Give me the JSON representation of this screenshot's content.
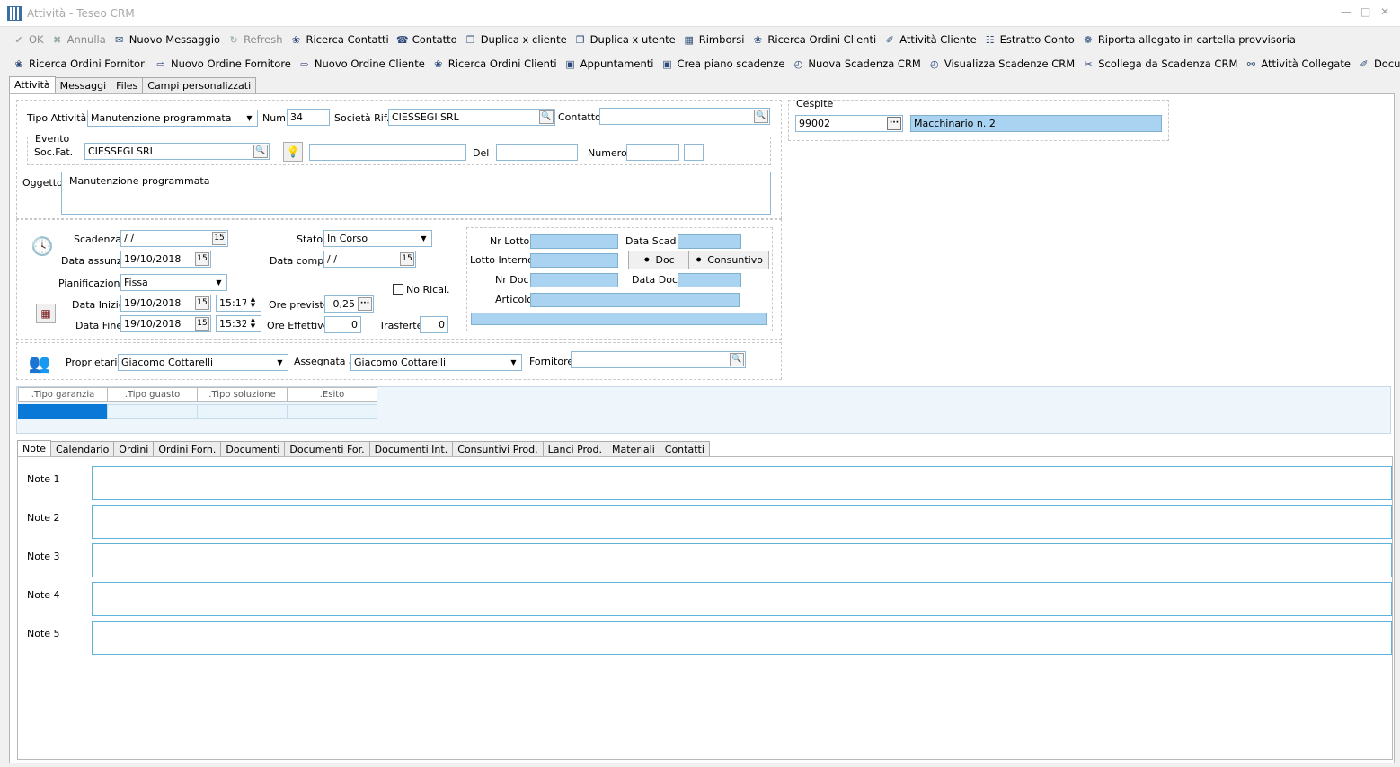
{
  "window": {
    "title": "Attività - Teseo CRM"
  },
  "toolbar1": [
    {
      "label": "OK",
      "icon": "check-icon",
      "disabled": true
    },
    {
      "label": "Annulla",
      "icon": "x-icon",
      "disabled": true
    },
    {
      "label": "Nuovo Messaggio",
      "icon": "envelope-icon"
    },
    {
      "label": "Refresh",
      "icon": "refresh-icon",
      "disabled": true
    },
    {
      "label": "Ricerca Contatti",
      "icon": "search-icon"
    },
    {
      "label": "Contatto",
      "icon": "contact-icon"
    },
    {
      "label": "Duplica x cliente",
      "icon": "copy-icon"
    },
    {
      "label": "Duplica x utente",
      "icon": "copy-icon"
    },
    {
      "label": "Rimborsi",
      "icon": "calculator-icon"
    },
    {
      "label": "Ricerca Ordini Clienti",
      "icon": "search-icon"
    },
    {
      "label": "Attività Cliente",
      "icon": "tag-icon"
    },
    {
      "label": "Estratto Conto",
      "icon": "statement-icon"
    },
    {
      "label": "Riporta allegato in cartella provvisoria",
      "icon": "attachment-icon"
    }
  ],
  "toolbar2": [
    {
      "label": "Ricerca Ordini Fornitori",
      "icon": "search-icon"
    },
    {
      "label": "Nuovo Ordine Fornitore",
      "icon": "arrow-icon"
    },
    {
      "label": "Nuovo Ordine Cliente",
      "icon": "arrow-icon"
    },
    {
      "label": "Ricerca Ordini Clienti",
      "icon": "search-icon"
    },
    {
      "label": "Appuntamenti",
      "icon": "calendar-icon"
    },
    {
      "label": "Crea piano scadenze",
      "icon": "calendar-icon"
    },
    {
      "label": "Nuova Scadenza CRM",
      "icon": "deadline-icon"
    },
    {
      "label": "Visualizza Scadenze CRM",
      "icon": "deadline-icon"
    },
    {
      "label": "Scollega da Scadenza CRM",
      "icon": "unlink-icon"
    },
    {
      "label": "Attività Collegate",
      "icon": "link-icon"
    },
    {
      "label": "Documenti CRM",
      "icon": "tag-icon"
    }
  ],
  "main_tabs": [
    "Attività",
    "Messaggi",
    "Files",
    "Campi personalizzati"
  ],
  "form": {
    "tipo_attivita_label": "Tipo Attività",
    "tipo_attivita": "Manutenzione programmata",
    "num_label": "Num.",
    "num": "34",
    "societa_label": "Società Rif.",
    "societa": "CIESSEGI SRL",
    "contatto_label": "Contatto",
    "contatto": "",
    "evento_label": "Evento",
    "socfat_label": "Soc.Fat.",
    "socfat": "CIESSEGI SRL",
    "evento_desc": "",
    "del_label": "Del",
    "del": "",
    "numero_label": "Numero",
    "numero": "",
    "numero2": "",
    "oggetto_label": "Oggetto",
    "oggetto": "Manutenzione programmata",
    "cespite_label": "Cespite",
    "cespite_code": "99002",
    "cespite_desc": "Macchinario n. 2",
    "scadenza_label": "Scadenza",
    "scadenza": " / /",
    "data_assunz_label": "Data assunz.",
    "data_assunz": "19/10/2018",
    "stato_label": "Stato",
    "stato": "In Corso",
    "data_compl_label": "Data compl.",
    "data_compl": " / /",
    "pianificazione_label": "Pianificazione",
    "pianificazione": "Fissa",
    "no_rical_label": "No Rical.",
    "data_inizio_label": "Data Inizio",
    "data_inizio": "19/10/2018",
    "ora_inizio": "15:17",
    "ore_previste_label": "Ore previste",
    "ore_previste": "0,25",
    "data_fine_label": "Data Fine",
    "data_fine": "19/10/2018",
    "ora_fine": "15:32",
    "ore_effettive_label": "Ore Effettive",
    "ore_effettive": "0",
    "trasferte_label": "Trasferte",
    "trasferte": "0",
    "nr_lotto_label": "Nr Lotto",
    "data_scad_label": "Data Scad",
    "lotto_interno_label": "Lotto Interno",
    "doc_button": "Doc",
    "consuntivo_button": "Consuntivo",
    "nr_doc_label": "Nr Doc",
    "data_doc_label": "Data Doc",
    "articolo_label": "Articolo",
    "proprietario_label": "Proprietario",
    "proprietario": "Giacomo Cottarelli",
    "assegnata_label": "Assegnata a",
    "assegnata": "Giacomo Cottarelli",
    "fornitore_label": "Fornitore",
    "fornitore": ""
  },
  "grid": {
    "columns": [
      ".Tipo garanzia",
      ".Tipo guasto",
      ".Tipo soluzione",
      ".Esito"
    ]
  },
  "bottom_tabs": [
    "Note",
    "Calendario",
    "Ordini",
    "Ordini Forn.",
    "Documenti",
    "Documenti For.",
    "Documenti Int.",
    "Consuntivi Prod.",
    "Lanci Prod.",
    "Materiali",
    "Contatti"
  ],
  "notes": [
    "Note 1",
    "Note 2",
    "Note 3",
    "Note 4",
    "Note 5"
  ]
}
